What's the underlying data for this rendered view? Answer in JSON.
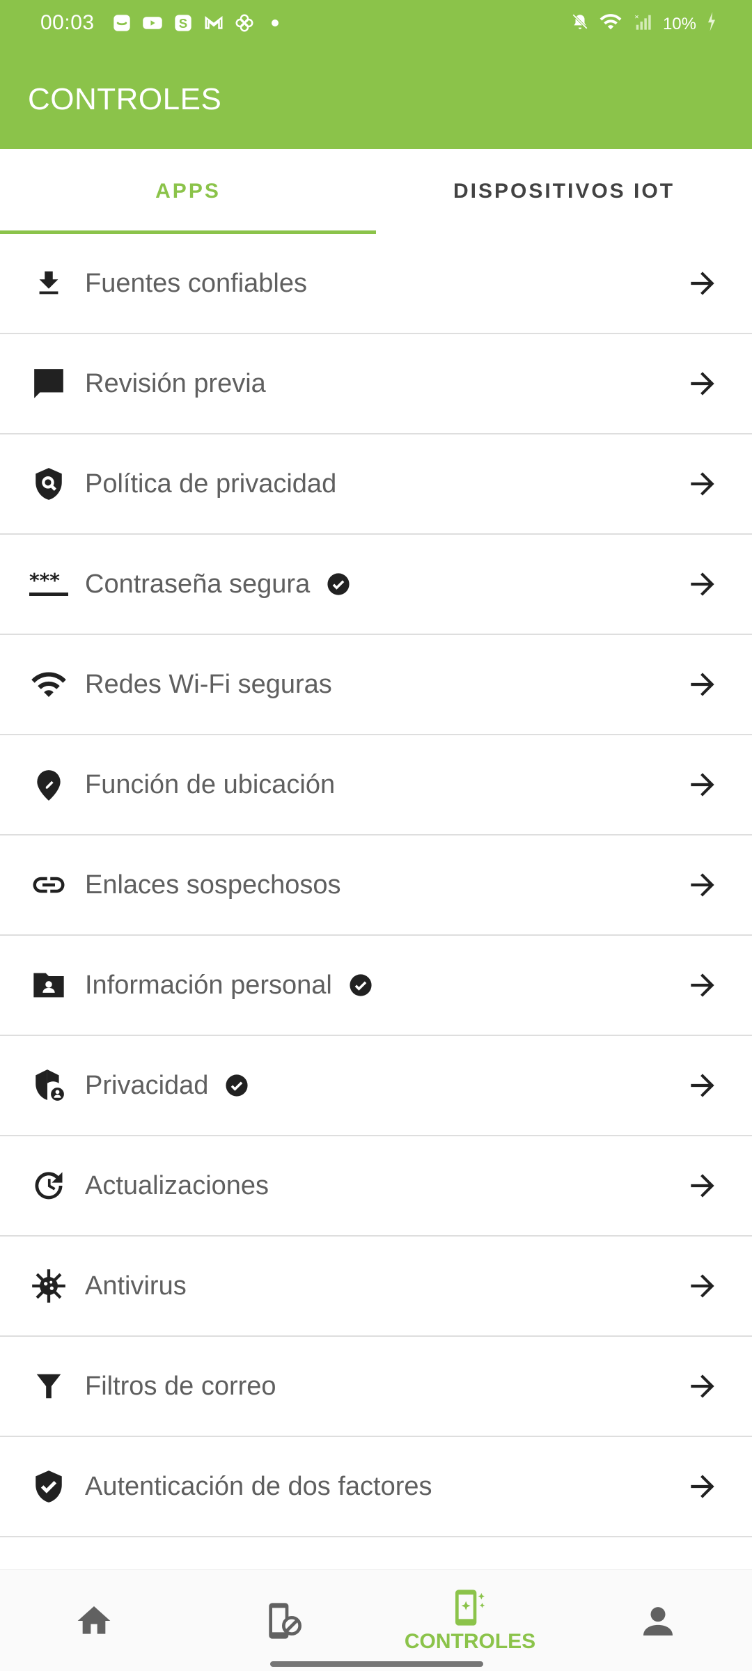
{
  "status_bar": {
    "time": "00:03",
    "battery": "10%",
    "left_icons": [
      "notification-icon",
      "youtube-icon",
      "s-app-icon",
      "gmail-icon",
      "pinwheel-icon",
      "dot-icon"
    ],
    "right_icons": [
      "mute-bell-icon",
      "wifi-icon",
      "no-signal-icon",
      "battery-icon"
    ]
  },
  "app_bar": {
    "title": "CONTROLES"
  },
  "tabs": [
    {
      "label": "APPS",
      "active": true
    },
    {
      "label": "DISPOSITIVOS IOT",
      "active": false
    }
  ],
  "controls": [
    {
      "label": "Fuentes confiables",
      "icon": "download-icon",
      "checked": false
    },
    {
      "label": "Revisión previa",
      "icon": "chat-bubble-icon",
      "checked": false
    },
    {
      "label": "Política de privacidad",
      "icon": "shield-search-icon",
      "checked": false
    },
    {
      "label": "Contraseña segura",
      "icon": "password-icon",
      "checked": true
    },
    {
      "label": "Redes Wi-Fi seguras",
      "icon": "wifi-icon",
      "checked": false
    },
    {
      "label": "Función de ubicación",
      "icon": "location-edit-icon",
      "checked": false
    },
    {
      "label": "Enlaces sospechosos",
      "icon": "link-icon",
      "checked": false
    },
    {
      "label": "Información personal",
      "icon": "folder-person-icon",
      "checked": true
    },
    {
      "label": "Privacidad",
      "icon": "shield-person-icon",
      "checked": true
    },
    {
      "label": "Actualizaciones",
      "icon": "update-icon",
      "checked": false
    },
    {
      "label": "Antivirus",
      "icon": "virus-icon",
      "checked": false
    },
    {
      "label": "Filtros de correo",
      "icon": "filter-icon",
      "checked": false
    },
    {
      "label": "Autenticación de dos factores",
      "icon": "verified-shield-icon",
      "checked": false
    }
  ],
  "bottom_nav": {
    "items": [
      {
        "icon": "home-icon",
        "label": ""
      },
      {
        "icon": "device-block-icon",
        "label": ""
      },
      {
        "icon": "controls-icon",
        "label": "CONTROLES",
        "active": true
      },
      {
        "icon": "person-icon",
        "label": ""
      }
    ]
  },
  "colors": {
    "accent": "#8bc34a",
    "text": "#5f5f5f",
    "divider": "#dedede"
  }
}
